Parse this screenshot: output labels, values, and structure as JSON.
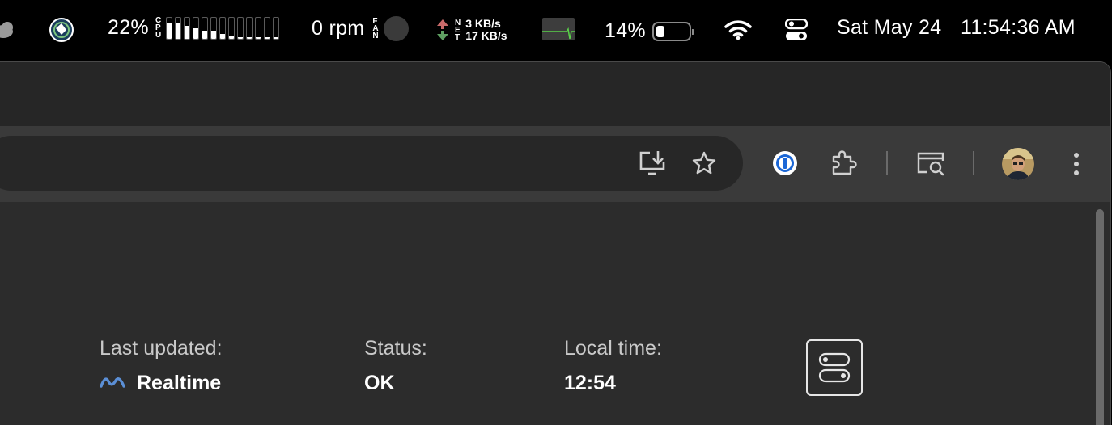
{
  "menubar": {
    "cpu": {
      "percent": "22%",
      "label_letters": [
        "C",
        "P",
        "U"
      ],
      "core_loads": [
        0.72,
        0.72,
        0.6,
        0.5,
        0.35,
        0.35,
        0.2,
        0.12,
        0.05,
        0.05,
        0.05,
        0.05,
        0.05
      ]
    },
    "fan": {
      "text": "0 rpm",
      "label_letters": [
        "F",
        "A",
        "N"
      ]
    },
    "network": {
      "label_letters": [
        "N",
        "E",
        "T"
      ],
      "upload": "3 KB/s",
      "download": "17 KB/s",
      "up_color": "#d9534f",
      "down_color": "#4caf50"
    },
    "battery": {
      "percent": "14%",
      "level": 0.14
    },
    "date": "Sat May 24",
    "time": "11:54:36 AM",
    "icons": [
      "weather-cloud-icon",
      "app-globe-icon",
      "activity-graph-icon",
      "wifi-icon",
      "control-center-icon"
    ]
  },
  "toolbar": {
    "icons": [
      "install-app-icon",
      "bookmark-star-icon",
      "password-manager-icon",
      "extensions-icon",
      "search-tab-icon",
      "profile-avatar",
      "more-menu-icon"
    ]
  },
  "content": {
    "last_updated": {
      "label": "Last updated:",
      "value": "Realtime",
      "accent": "#5b8fd6"
    },
    "status": {
      "label": "Status:",
      "value": "OK"
    },
    "local_time": {
      "label": "Local time:",
      "value": "12:54"
    }
  }
}
